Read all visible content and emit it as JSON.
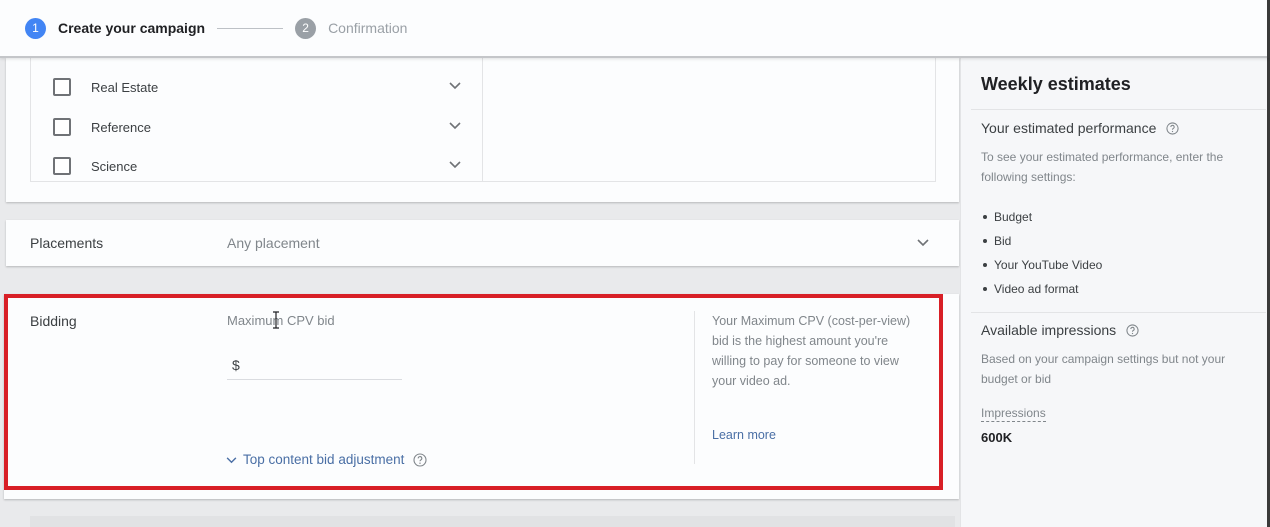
{
  "stepper": {
    "steps": [
      {
        "number": "1",
        "label": "Create your campaign",
        "state": "active"
      },
      {
        "number": "2",
        "label": "Confirmation",
        "state": "inactive"
      }
    ]
  },
  "topics": {
    "items": [
      {
        "label": "Real Estate",
        "checked": false
      },
      {
        "label": "Reference",
        "checked": false
      },
      {
        "label": "Science",
        "checked": false
      }
    ]
  },
  "placements": {
    "label": "Placements",
    "value": "Any placement"
  },
  "bidding": {
    "label": "Bidding",
    "field_label": "Maximum CPV bid",
    "currency_symbol": "$",
    "input_value": "",
    "top_content_link": "Top content bid adjustment",
    "help_text": "Your Maximum CPV (cost-per-view) bid is the highest amount you're willing to pay for someone to view your video ad.",
    "learn_more": "Learn more",
    "highlight_color": "#d81f26"
  },
  "weekly_estimates": {
    "title": "Weekly estimates",
    "performance": {
      "heading": "Your estimated performance",
      "description": "To see your estimated performance, enter the following settings:",
      "requirements": [
        "Budget",
        "Bid",
        "Your YouTube Video",
        "Video ad format"
      ]
    },
    "impressions": {
      "heading": "Available impressions",
      "description": "Based on your campaign settings but not your budget or bid",
      "metric_label": "Impressions",
      "metric_value": "600K"
    }
  },
  "colors": {
    "accent": "#4285f4",
    "link": "#4a6fa5",
    "muted": "#80868b"
  }
}
